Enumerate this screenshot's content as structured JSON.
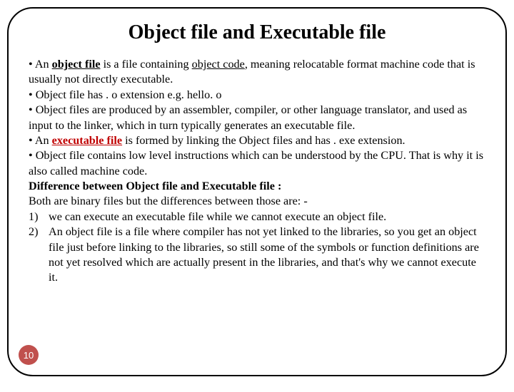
{
  "title": "Object file and Executable file",
  "bullets": {
    "b1_pre": "• An ",
    "b1_term": "object file",
    "b1_mid": " is a file containing ",
    "b1_term2": "object code",
    "b1_post": ", meaning relocatable format machine code that is usually not directly executable.",
    "b2": "• Object file has . o extension e.g. hello. o",
    "b3": "• Object files are produced by an assembler, compiler, or other language translator, and used as input to the linker, which in turn typically generates an executable  file.",
    "b4_pre": "• An ",
    "b4_term": "executable file",
    "b4_post": " is formed by linking the Object files and has . exe extension.",
    "b5": "• Object file contains low level instructions which can be understood by the CPU. That is why it is also called machine code."
  },
  "diff_heading": "Difference between Object file and Executable file :",
  "diff_intro": "Both are binary files but the differences between those are: -",
  "diff_items": {
    "n1": "1)",
    "t1": "we can execute an executable file while we cannot execute an object file.",
    "n2": "2)",
    "t2": "An object file is a file where compiler has not yet linked to the libraries, so you get an object file just before linking to the libraries, so still some of the symbols or function definitions are not yet resolved which are actually present in the libraries, and that's why we cannot execute it."
  },
  "page_number": "10"
}
